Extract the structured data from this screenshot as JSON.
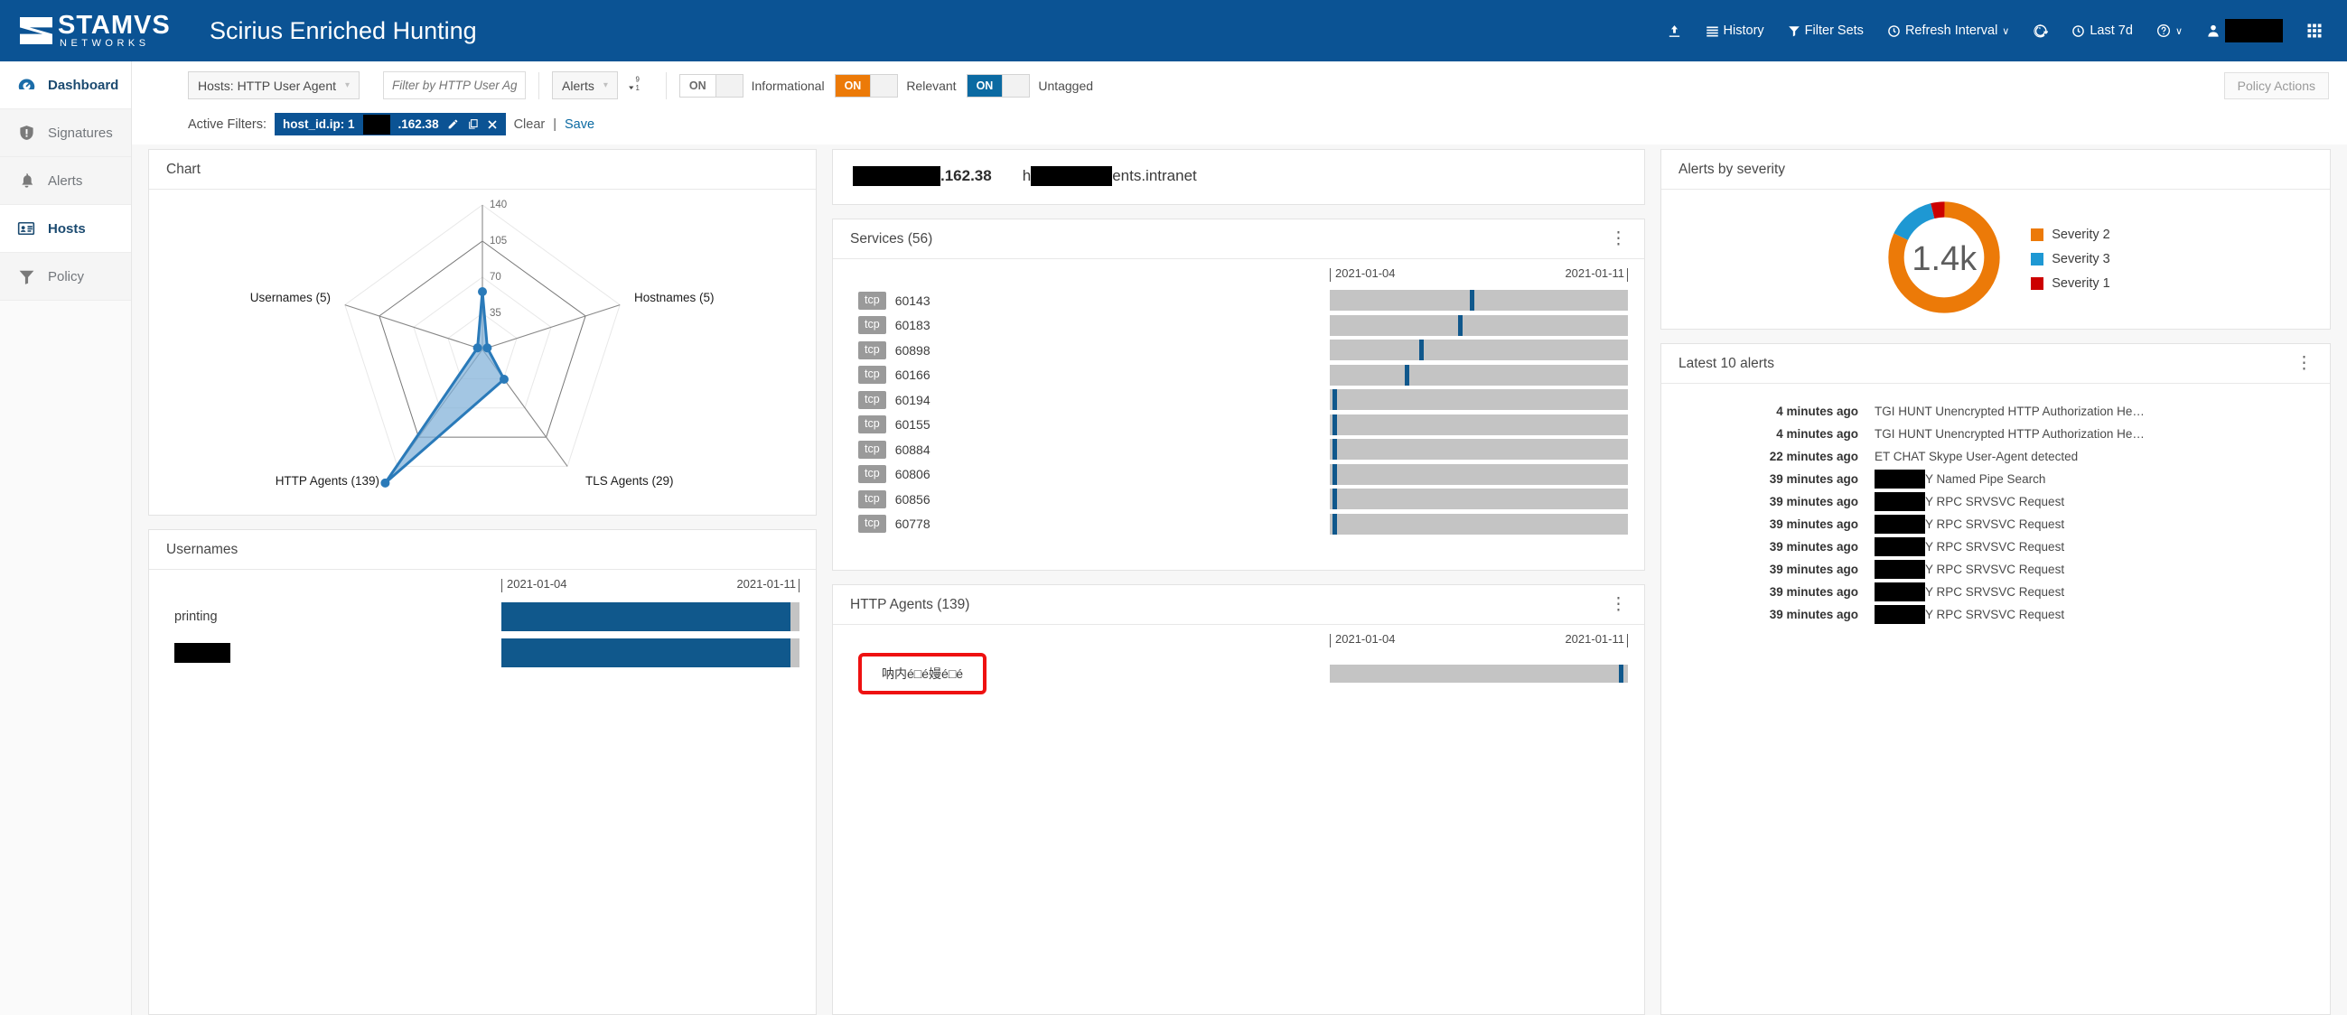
{
  "topbar": {
    "logo_line1": "STAMVS",
    "logo_line2": "NETWORKS",
    "app_title": "Scirius Enriched Hunting",
    "items": [
      {
        "label": "",
        "icon": "upload-icon"
      },
      {
        "label": "History",
        "icon": "list-icon"
      },
      {
        "label": "Filter Sets",
        "icon": "funnel-icon"
      },
      {
        "label": "Refresh Interval",
        "icon": "clock-icon",
        "caret": "∨"
      },
      {
        "label": "",
        "icon": "refresh-icon"
      },
      {
        "label": "Last 7d",
        "icon": "clock-icon"
      },
      {
        "label": "",
        "icon": "help-icon",
        "caret": "∨"
      },
      {
        "label": "",
        "icon": "user-icon"
      },
      {
        "label": "",
        "icon": "grid-icon"
      }
    ]
  },
  "sidebar": {
    "items": [
      {
        "label": "Dashboard",
        "icon": "gauge-icon",
        "active": true
      },
      {
        "label": "Signatures",
        "icon": "shield-icon",
        "active": false
      },
      {
        "label": "Alerts",
        "icon": "bell-icon",
        "active": false
      },
      {
        "label": "Hosts",
        "icon": "idcard-icon",
        "active": true
      },
      {
        "label": "Policy",
        "icon": "funnel-icon",
        "active": false
      }
    ]
  },
  "filterbar": {
    "scope_select": "Hosts: HTTP User Agent",
    "filter_placeholder": "Filter by HTTP User Agent",
    "type_select": "Alerts",
    "sort_icon": "sort-desc-icon",
    "toggles": [
      {
        "state": "ON",
        "color": "grey",
        "label": "Informational"
      },
      {
        "state": "ON",
        "color": "orange",
        "label": "Relevant"
      },
      {
        "state": "ON",
        "color": "blue",
        "label": "Untagged"
      }
    ],
    "policy_actions": "Policy Actions"
  },
  "active_filters": {
    "label": "Active Filters:",
    "chip_prefix": "host_id.ip: 1",
    "chip_suffix": ".162.38",
    "clear": "Clear",
    "divider": "|",
    "save": "Save"
  },
  "chart_card": {
    "title": "Chart"
  },
  "chart_data": {
    "type": "radar",
    "title": "Chart",
    "categories": [
      "Services (56)",
      "Hostnames (5)",
      "TLS Agents (29)",
      "HTTP Agents (139)",
      "Usernames (5)"
    ],
    "values": [
      56,
      5,
      29,
      139,
      5
    ],
    "ticks": [
      35,
      70,
      105,
      140
    ],
    "rmax": 140,
    "grid": true,
    "fill_color": "#7fb0d8",
    "line_color": "#2a7ab9"
  },
  "host": {
    "ip_suffix": ".162.38",
    "name_prefix": "h",
    "name_suffix": "ents.intranet"
  },
  "services": {
    "title": "Services (56)",
    "axis_start": "2021-01-04",
    "axis_end": "2021-01-11",
    "rows": [
      {
        "proto": "tcp",
        "port": "60143",
        "pos": 47
      },
      {
        "proto": "tcp",
        "port": "60183",
        "pos": 43
      },
      {
        "proto": "tcp",
        "port": "60898",
        "pos": 30
      },
      {
        "proto": "tcp",
        "port": "60166",
        "pos": 25
      },
      {
        "proto": "tcp",
        "port": "60194",
        "pos": 1
      },
      {
        "proto": "tcp",
        "port": "60155",
        "pos": 1
      },
      {
        "proto": "tcp",
        "port": "60884",
        "pos": 1
      },
      {
        "proto": "tcp",
        "port": "60806",
        "pos": 1
      },
      {
        "proto": "tcp",
        "port": "60856",
        "pos": 1
      },
      {
        "proto": "tcp",
        "port": "60778",
        "pos": 1
      }
    ]
  },
  "http_agents": {
    "title": "HTTP Agents (139)",
    "axis_start": "2021-01-04",
    "axis_end": "2021-01-11",
    "rows": [
      {
        "label": "呐内é□é嫚é□é",
        "highlighted": true,
        "pos": 97
      }
    ]
  },
  "usernames": {
    "title": "Usernames",
    "axis_start": "2021-01-04",
    "axis_end": "2021-01-11",
    "rows": [
      {
        "label": "printing",
        "redacted": false,
        "fill": 97
      },
      {
        "label": "",
        "redacted": true,
        "fill": 97
      }
    ]
  },
  "severity": {
    "title": "Alerts by severity",
    "center_value": "1.4k"
  },
  "severity_chart_data": {
    "type": "pie",
    "title": "Alerts by severity",
    "labels": [
      "Severity 2",
      "Severity 3",
      "Severity 1"
    ],
    "values": [
      82,
      14,
      4
    ],
    "colors": [
      "#ec7a08",
      "#1e98d3",
      "#cc0000"
    ],
    "center_label": "1.4k",
    "legend_position": "right",
    "donut": true
  },
  "latest_alerts": {
    "title": "Latest 10 alerts",
    "rows": [
      {
        "time": "4 minutes ago",
        "redacted": false,
        "msg": "TGI HUNT Unencrypted HTTP Authorization He…"
      },
      {
        "time": "4 minutes ago",
        "redacted": false,
        "msg": "TGI HUNT Unencrypted HTTP Authorization He…"
      },
      {
        "time": "22 minutes ago",
        "redacted": false,
        "msg": "ET CHAT Skype User-Agent detected"
      },
      {
        "time": "39 minutes ago",
        "redacted": true,
        "msg": "Y Named Pipe Search"
      },
      {
        "time": "39 minutes ago",
        "redacted": true,
        "msg": "Y RPC SRVSVC Request"
      },
      {
        "time": "39 minutes ago",
        "redacted": true,
        "msg": "Y RPC SRVSVC Request"
      },
      {
        "time": "39 minutes ago",
        "redacted": true,
        "msg": "Y RPC SRVSVC Request"
      },
      {
        "time": "39 minutes ago",
        "redacted": true,
        "msg": "Y RPC SRVSVC Request"
      },
      {
        "time": "39 minutes ago",
        "redacted": true,
        "msg": "Y RPC SRVSVC Request"
      },
      {
        "time": "39 minutes ago",
        "redacted": true,
        "msg": "Y RPC SRVSVC Request"
      }
    ]
  }
}
